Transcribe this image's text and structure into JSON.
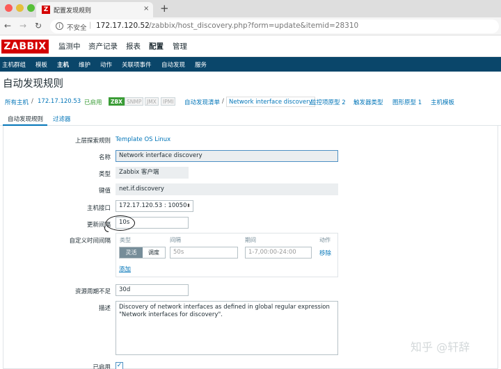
{
  "browser": {
    "tab_title": "配置发现规则",
    "favicon_letter": "Z",
    "tab_close": "×",
    "new_tab": "+",
    "insecure_label": "不安全",
    "url_host": "172.17.120.52",
    "url_path": "/zabbix/host_discovery.php?form=update&itemid=28310"
  },
  "header": {
    "logo": "ZABBIX",
    "nav": [
      "监测中",
      "资产记录",
      "报表",
      "配置",
      "管理"
    ]
  },
  "submenu": [
    "主机群组",
    "模板",
    "主机",
    "维护",
    "动作",
    "关联项事件",
    "自动发现",
    "服务"
  ],
  "page_title": "自动发现规则",
  "breadcrumb": {
    "all_hosts": "所有主机",
    "sep": "/",
    "host": "172.17.120.53",
    "enabled": "已启用",
    "zbx": "ZBX",
    "snmp": "SNMP",
    "jmx": "JMX",
    "ipmi": "IPMI",
    "discovery_list": "自动发现清单",
    "current": "Network interface discovery",
    "item_prototypes": "监控项原型 2",
    "trigger_types": "触发器类型",
    "graph_prototypes": "图形原型 1",
    "host_templates": "主机模板"
  },
  "form_tabs": [
    "自动发现规则",
    "过滤器"
  ],
  "form": {
    "parent_rule_label": "上层探索规则",
    "parent_rule_value": "Template OS Linux",
    "name_label": "名称",
    "name_value": "Network interface discovery",
    "type_label": "类型",
    "type_value": "Zabbix 客户端",
    "key_label": "键值",
    "key_value": "net.if.discovery",
    "interface_label": "主机接口",
    "interface_value": "172.17.120.53 : 10050",
    "interval_label": "更新间隔",
    "interval_value": "10s",
    "custom_interval_label": "自定义时间间隔",
    "ci_col_type": "类型",
    "ci_col_interval": "间隔",
    "ci_col_period": "期间",
    "ci_col_action": "动作",
    "ci_flexible": "灵活",
    "ci_scheduling": "调度",
    "ci_interval_placeholder": "50s",
    "ci_period_placeholder": "1-7,00:00-24:00",
    "ci_remove": "移除",
    "ci_add": "添加",
    "lifetime_label": "资源周期不足",
    "lifetime_value": "30d",
    "description_label": "描述",
    "description_value": "Discovery of network interfaces as defined in global regular expression \"Network interfaces for discovery\".",
    "enabled_label": "已启用",
    "enabled_check": "✓"
  },
  "watermark": "知乎 @轩辞"
}
